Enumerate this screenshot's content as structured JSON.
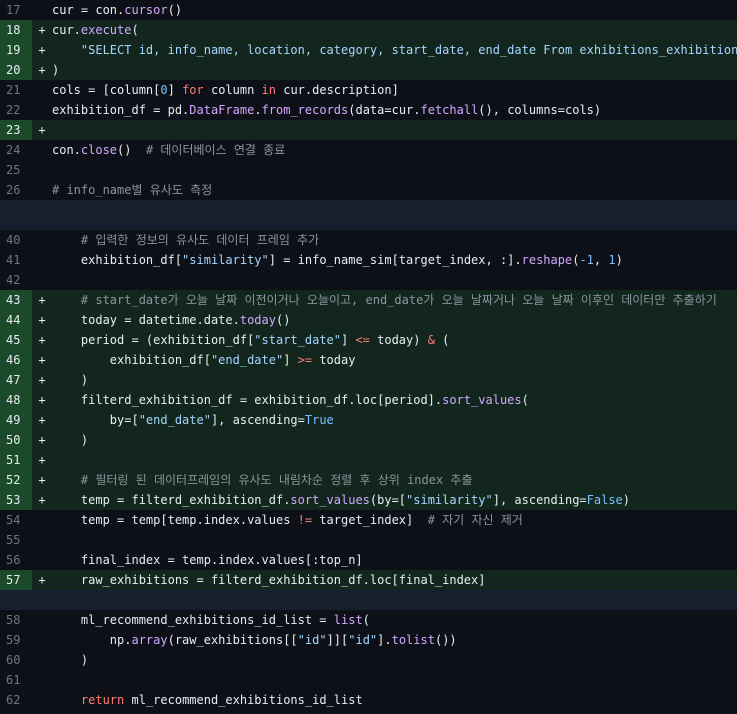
{
  "diff": {
    "lines": [
      {
        "type": "ctx",
        "num": "17",
        "marker": "",
        "code": "cur = con.<f>cursor</f>()"
      },
      {
        "type": "add",
        "num": "18",
        "marker": "+",
        "code": "cur.<f>execute</f>("
      },
      {
        "type": "add",
        "num": "19",
        "marker": "+",
        "code": "    <s>\"SELECT id, info_name, location, category, start_date, end_date From exhibitions_exhibition\"</s>"
      },
      {
        "type": "add",
        "num": "20",
        "marker": "+",
        "code": ")"
      },
      {
        "type": "ctx",
        "num": "21",
        "marker": "",
        "code": "cols = [column[<n>0</n>] <k>for</k> column <k>in</k> cur.description]"
      },
      {
        "type": "ctx",
        "num": "22",
        "marker": "",
        "code": "exhibition_df = pd.<f>DataFrame</f>.<f>from_records</f>(data=cur.<f>fetchall</f>(), columns=cols)"
      },
      {
        "type": "add",
        "num": "23",
        "marker": "+",
        "code": ""
      },
      {
        "type": "ctx",
        "num": "24",
        "marker": "",
        "code": "con.<f>close</f>()  <c># 데이터베이스 연결 종료</c>"
      },
      {
        "type": "ctx",
        "num": "25",
        "marker": "",
        "code": ""
      },
      {
        "type": "ctx",
        "num": "26",
        "marker": "",
        "code": "<c># info_name별 유사도 측정</c>"
      },
      {
        "type": "sep-tall",
        "num": "",
        "marker": "",
        "code": ""
      },
      {
        "type": "ctx",
        "num": "40",
        "marker": "",
        "code": "    <c># 입력한 정보의 유사도 데이터 프레임 추가</c>"
      },
      {
        "type": "ctx",
        "num": "41",
        "marker": "",
        "code": "    exhibition_df[<s>\"similarity\"</s>] = info_name_sim[target_index, :].<f>reshape</f>(<n>-1</n>, <n>1</n>)"
      },
      {
        "type": "ctx",
        "num": "42",
        "marker": "",
        "code": ""
      },
      {
        "type": "add",
        "num": "43",
        "marker": "+",
        "code": "    <c># start_date가 오늘 날짜 이전이거나 오늘이고, end_date가 오늘 날짜거나 오늘 날짜 이후인 데이터만 추출하기</c>"
      },
      {
        "type": "add",
        "num": "44",
        "marker": "+",
        "code": "    today = datetime.date.<f>today</f>()"
      },
      {
        "type": "add",
        "num": "45",
        "marker": "+",
        "code": "    period = (exhibition_df[<s>\"start_date\"</s>] <o>&lt;=</o> today) <o>&amp;</o> ("
      },
      {
        "type": "add",
        "num": "46",
        "marker": "+",
        "code": "        exhibition_df[<s>\"end_date\"</s>] <o>&gt;=</o> today"
      },
      {
        "type": "add",
        "num": "47",
        "marker": "+",
        "code": "    )"
      },
      {
        "type": "add",
        "num": "48",
        "marker": "+",
        "code": "    filterd_exhibition_df = exhibition_df.loc[period].<f>sort_values</f>("
      },
      {
        "type": "add",
        "num": "49",
        "marker": "+",
        "code": "        by=[<s>\"end_date\"</s>], ascending=<n>True</n>"
      },
      {
        "type": "add",
        "num": "50",
        "marker": "+",
        "code": "    )"
      },
      {
        "type": "add",
        "num": "51",
        "marker": "+",
        "code": ""
      },
      {
        "type": "add",
        "num": "52",
        "marker": "+",
        "code": "    <c># 필터링 된 데이터프레임의 유사도 내림차순 정렬 후 상위 index 추출</c>"
      },
      {
        "type": "add",
        "num": "53",
        "marker": "+",
        "code": "    temp = filterd_exhibition_df.<f>sort_values</f>(by=[<s>\"similarity\"</s>], ascending=<n>False</n>)"
      },
      {
        "type": "ctx",
        "num": "54",
        "marker": "",
        "code": "    temp = temp[temp.index.values <o>!=</o> target_index]  <c># 자기 자신 제거</c>"
      },
      {
        "type": "ctx",
        "num": "55",
        "marker": "",
        "code": ""
      },
      {
        "type": "ctx",
        "num": "56",
        "marker": "",
        "code": "    final_index = temp.index.values[:top_n]"
      },
      {
        "type": "add",
        "num": "57",
        "marker": "+",
        "code": "    raw_exhibitions = filterd_exhibition_df.loc[final_index]"
      },
      {
        "type": "sep",
        "num": "",
        "marker": "",
        "code": ""
      },
      {
        "type": "ctx",
        "num": "58",
        "marker": "",
        "code": "    ml_recommend_exhibitions_id_list = <f>list</f>("
      },
      {
        "type": "ctx",
        "num": "59",
        "marker": "",
        "code": "        np.<f>array</f>(raw_exhibitions[[<s>\"id\"</s>]][<s>\"id\"</s>].<f>tolist</f>())"
      },
      {
        "type": "ctx",
        "num": "60",
        "marker": "",
        "code": "    )"
      },
      {
        "type": "ctx",
        "num": "61",
        "marker": "",
        "code": ""
      },
      {
        "type": "ctx",
        "num": "62",
        "marker": "",
        "code": "    <k>return</k> ml_recommend_exhibitions_id_list"
      }
    ]
  }
}
